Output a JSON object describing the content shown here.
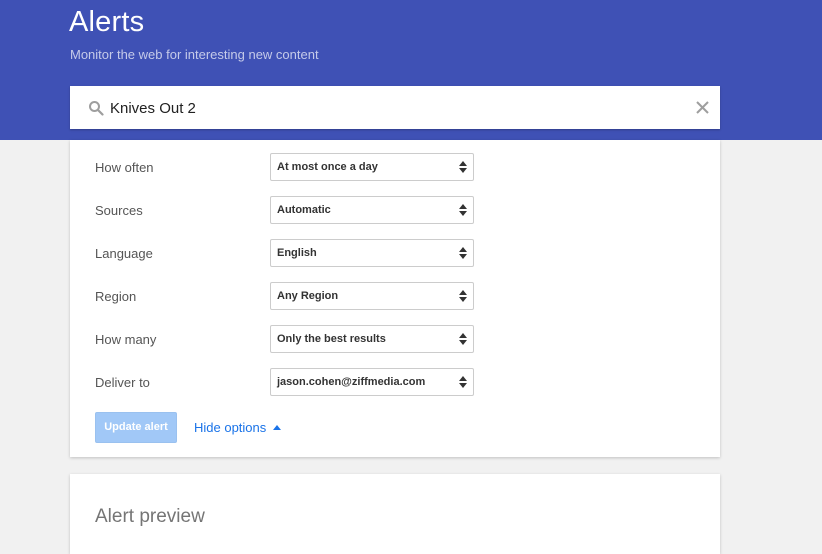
{
  "header": {
    "title": "Alerts",
    "subtitle": "Monitor the web for interesting new content"
  },
  "search": {
    "value": "Knives Out 2",
    "icon": "search-icon",
    "clear_icon": "close-icon"
  },
  "options": {
    "how_often": {
      "label": "How often",
      "value": "At most once a day"
    },
    "sources": {
      "label": "Sources",
      "value": "Automatic"
    },
    "language": {
      "label": "Language",
      "value": "English"
    },
    "region": {
      "label": "Region",
      "value": "Any Region"
    },
    "how_many": {
      "label": "How many",
      "value": "Only the best results"
    },
    "deliver_to": {
      "label": "Deliver to",
      "value": "jason.cohen@ziffmedia.com"
    }
  },
  "actions": {
    "update_label": "Update alert",
    "hide_options_label": "Hide options"
  },
  "preview": {
    "title": "Alert preview"
  },
  "colors": {
    "header_bg": "#3f51b5",
    "link": "#1a73e8",
    "button_disabled": "#a1c8f7"
  }
}
